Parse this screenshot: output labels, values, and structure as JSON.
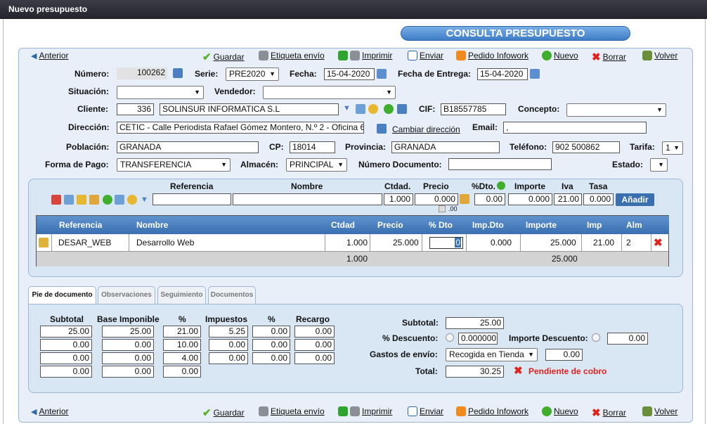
{
  "window_title": "Nuevo presupuesto",
  "banner": "CONSULTA PRESUPUESTO",
  "toolbar": {
    "anterior": "Anterior",
    "guardar": "Guardar",
    "etiqueta": "Etiqueta envío",
    "imprimir": "Imprimir",
    "enviar": "Enviar",
    "pedido": "Pedido Infowork",
    "nuevo": "Nuevo",
    "borrar": "Borrar",
    "volver": "Volver"
  },
  "form": {
    "numero_label": "Número:",
    "numero": "100262",
    "serie_label": "Serie:",
    "serie": "PRE2020",
    "fecha_label": "Fecha:",
    "fecha": "15-04-2020",
    "fecha_entrega_label": "Fecha de Entrega:",
    "fecha_entrega": "15-04-2020",
    "situacion_label": "Situación:",
    "situacion": "",
    "vendedor_label": "Vendedor:",
    "vendedor": "",
    "cliente_label": "Cliente:",
    "cliente_codigo": "336",
    "cliente_nombre": "SOLINSUR INFORMATICA S.L",
    "cif_label": "CIF:",
    "cif": "B18557785",
    "concepto_label": "Concepto:",
    "concepto": "",
    "direccion_label": "Dirección:",
    "direccion": "CETIC - Calle Periodista Rafael Gómez Montero, N.º 2 - Oficina 6",
    "cambiar_direccion": "Cambiar dirección",
    "email_label": "Email:",
    "email": ",",
    "poblacion_label": "Población:",
    "poblacion": "GRANADA",
    "cp_label": "CP:",
    "cp": "18014",
    "provincia_label": "Provincia:",
    "provincia": "GRANADA",
    "telefono_label": "Teléfono:",
    "telefono": "902 500862",
    "tarifa_label": "Tarifa:",
    "tarifa": "1",
    "forma_pago_label": "Forma de Pago:",
    "forma_pago": "TRANSFERENCIA",
    "almacen_label": "Almacén:",
    "almacen": "PRINCIPAL",
    "num_documento_label": "Número Documento:",
    "num_documento": "",
    "estado_label": "Estado:",
    "estado": ""
  },
  "entry": {
    "h_referencia": "Referencia",
    "h_nombre": "Nombre",
    "h_ctdad": "Ctdad.",
    "h_precio": "Precio",
    "h_dto": "%Dto.",
    "h_importe": "Importe",
    "h_iva": "Iva",
    "h_tasa": "Tasa",
    "referencia": "",
    "nombre": "",
    "ctdad": "1.000",
    "precio": "0.000",
    "precio_sub": ".00",
    "dto": "0.00",
    "importe": "0.000",
    "iva": "21.00",
    "tasa": "0.000",
    "anadir": "Añadir"
  },
  "lines": {
    "headers": [
      "Referencia",
      "Nombre",
      "Ctdad",
      "Precio",
      "% Dto",
      "Imp.Dto",
      "Importe",
      "Imp",
      "Alm"
    ],
    "row": {
      "referencia": "DESAR_WEB",
      "nombre": "Desarrollo Web",
      "ctdad": "1.000",
      "precio": "25.000",
      "dto": "0",
      "imp_dto": "0.000",
      "importe": "25.000",
      "imp": "21.00",
      "alm": "2"
    },
    "totals": {
      "ctdad": "1.000",
      "importe": "25.000"
    }
  },
  "tabs": [
    "Pie de documento",
    "Observaciones",
    "Seguimiento",
    "Documentos"
  ],
  "pie": {
    "h_subtotal": "Subtotal",
    "h_base": "Base Imponible",
    "h_pct": "%",
    "h_impuestos": "Impuestos",
    "h_pct2": "%",
    "h_recargo": "Recargo",
    "rows": [
      {
        "subtotal": "25.00",
        "base": "25.00",
        "pct": "21.00",
        "impuestos": "5.25",
        "pct2": "0.00",
        "recargo": "0.00"
      },
      {
        "subtotal": "0.00",
        "base": "0.00",
        "pct": "10.00",
        "impuestos": "0.00",
        "pct2": "0.00",
        "recargo": "0.00"
      },
      {
        "subtotal": "0.00",
        "base": "0.00",
        "pct": "4.00",
        "impuestos": "0.00",
        "pct2": "0.00",
        "recargo": "0.00"
      },
      {
        "subtotal": "0.00",
        "base": "0.00",
        "pct": "0.00"
      }
    ],
    "subtotal_label": "Subtotal:",
    "subtotal": "25.00",
    "descuento_label": "% Descuento:",
    "descuento": "0.000000",
    "importe_descuento_label": "Importe Descuento:",
    "importe_descuento": "0.00",
    "gastos_label": "Gastos de envío:",
    "gastos_tipo": "Recogida en Tienda",
    "gastos": "0.00",
    "total_label": "Total:",
    "total": "30.25",
    "pendiente": "Pendiente de cobro"
  },
  "colors": {
    "accent": "#3a6fb0",
    "danger": "#e0221c",
    "ok": "#2fa52f"
  }
}
